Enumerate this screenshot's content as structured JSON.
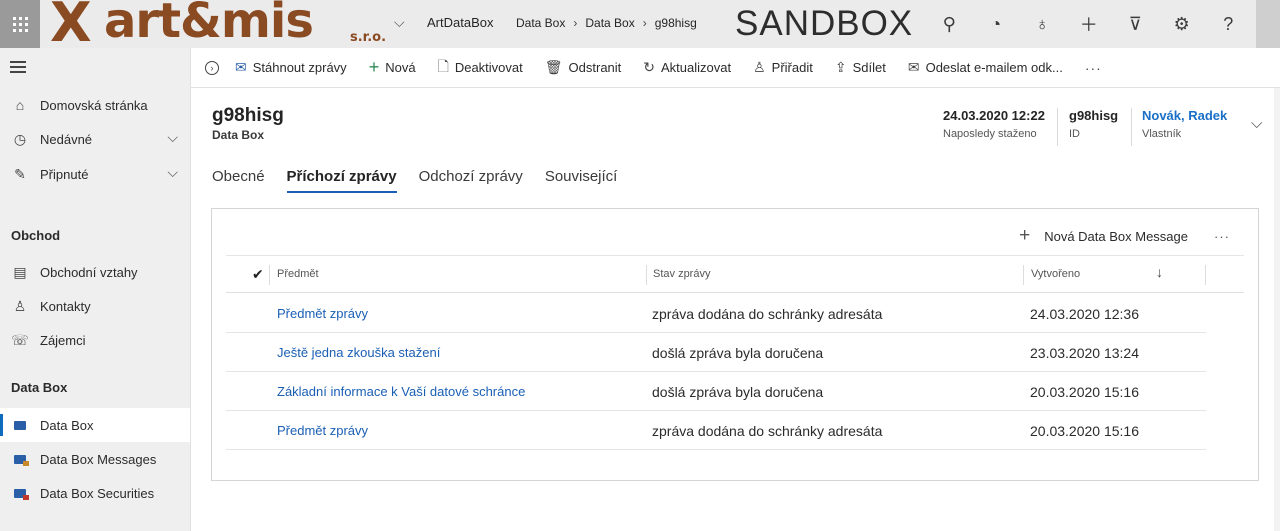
{
  "topbar": {
    "brand": {
      "mark": "X",
      "word": "art&mis",
      "suffix": "s.r.o."
    },
    "app_name": "ArtDataBox",
    "breadcrumb": [
      "Data Box",
      "Data Box",
      "g98hisg"
    ],
    "environment": "SANDBOX",
    "icons": [
      "search-icon",
      "task-icon",
      "lightbulb-icon",
      "plus-icon",
      "filter-icon",
      "gear-icon",
      "help-icon"
    ]
  },
  "sidebar": {
    "items_top": [
      {
        "label": "Domovská stránka",
        "icon": "home-icon"
      },
      {
        "label": "Nedávné",
        "icon": "clock-icon",
        "expandable": true
      },
      {
        "label": "Připnuté",
        "icon": "pin-icon",
        "expandable": true
      }
    ],
    "group_obchod": "Obchod",
    "items_obchod": [
      {
        "label": "Obchodní vztahy",
        "icon": "account-icon"
      },
      {
        "label": "Kontakty",
        "icon": "contact-icon"
      },
      {
        "label": "Zájemci",
        "icon": "lead-icon"
      }
    ],
    "group_databox": "Data Box",
    "items_databox": [
      {
        "label": "Data Box",
        "icon": "folder-icon",
        "selected": true
      },
      {
        "label": "Data Box Messages",
        "icon": "folder-message-icon"
      },
      {
        "label": "Data Box Securities",
        "icon": "folder-security-icon"
      }
    ]
  },
  "commandbar": {
    "buttons": [
      {
        "label": "Stáhnout zprávy",
        "icon": "download-mail-icon"
      },
      {
        "label": "Nová",
        "icon": "plus-icon"
      },
      {
        "label": "Deaktivovat",
        "icon": "deactivate-icon"
      },
      {
        "label": "Odstranit",
        "icon": "trash-icon"
      },
      {
        "label": "Aktualizovat",
        "icon": "refresh-icon"
      },
      {
        "label": "Přiřadit",
        "icon": "assign-icon"
      },
      {
        "label": "Sdílet",
        "icon": "share-icon"
      },
      {
        "label": "Odeslat e-mailem odk...",
        "icon": "email-link-icon"
      }
    ],
    "more": "···"
  },
  "record": {
    "title": "g98hisg",
    "subtitle": "Data Box",
    "fields": [
      {
        "value": "24.03.2020 12:22",
        "label": "Naposledy staženo"
      },
      {
        "value": "g98hisg",
        "label": "ID"
      },
      {
        "value": "Novák, Radek",
        "label": "Vlastník",
        "link": true
      }
    ]
  },
  "tabs": [
    "Obecné",
    "Příchozí zprávy",
    "Odchozí zprávy",
    "Související"
  ],
  "active_tab": 1,
  "subgrid": {
    "new_button": "Nová Data Box Message",
    "more": "···",
    "columns": [
      "Předmět",
      "Stav zprávy",
      "Vytvořeno"
    ],
    "sort_indicator": "↓",
    "rows": [
      {
        "subject": "Předmět zprávy",
        "status": "zpráva dodána do schránky adresáta",
        "created": "24.03.2020 12:36"
      },
      {
        "subject": "Ještě jedna zkouška stažení",
        "status": "došlá zpráva byla doručena",
        "created": "23.03.2020 13:24"
      },
      {
        "subject": "Základní informace k Vaší datové schránce",
        "status": "došlá zpráva byla doručena",
        "created": "20.03.2020 15:16"
      },
      {
        "subject": "Předmět zprávy",
        "status": "zpráva dodána do schránky adresáta",
        "created": "20.03.2020 15:16"
      }
    ]
  },
  "colors": {
    "accent": "#1a5fb4",
    "brand": "#8a4a22",
    "link": "#1a6fc7"
  }
}
